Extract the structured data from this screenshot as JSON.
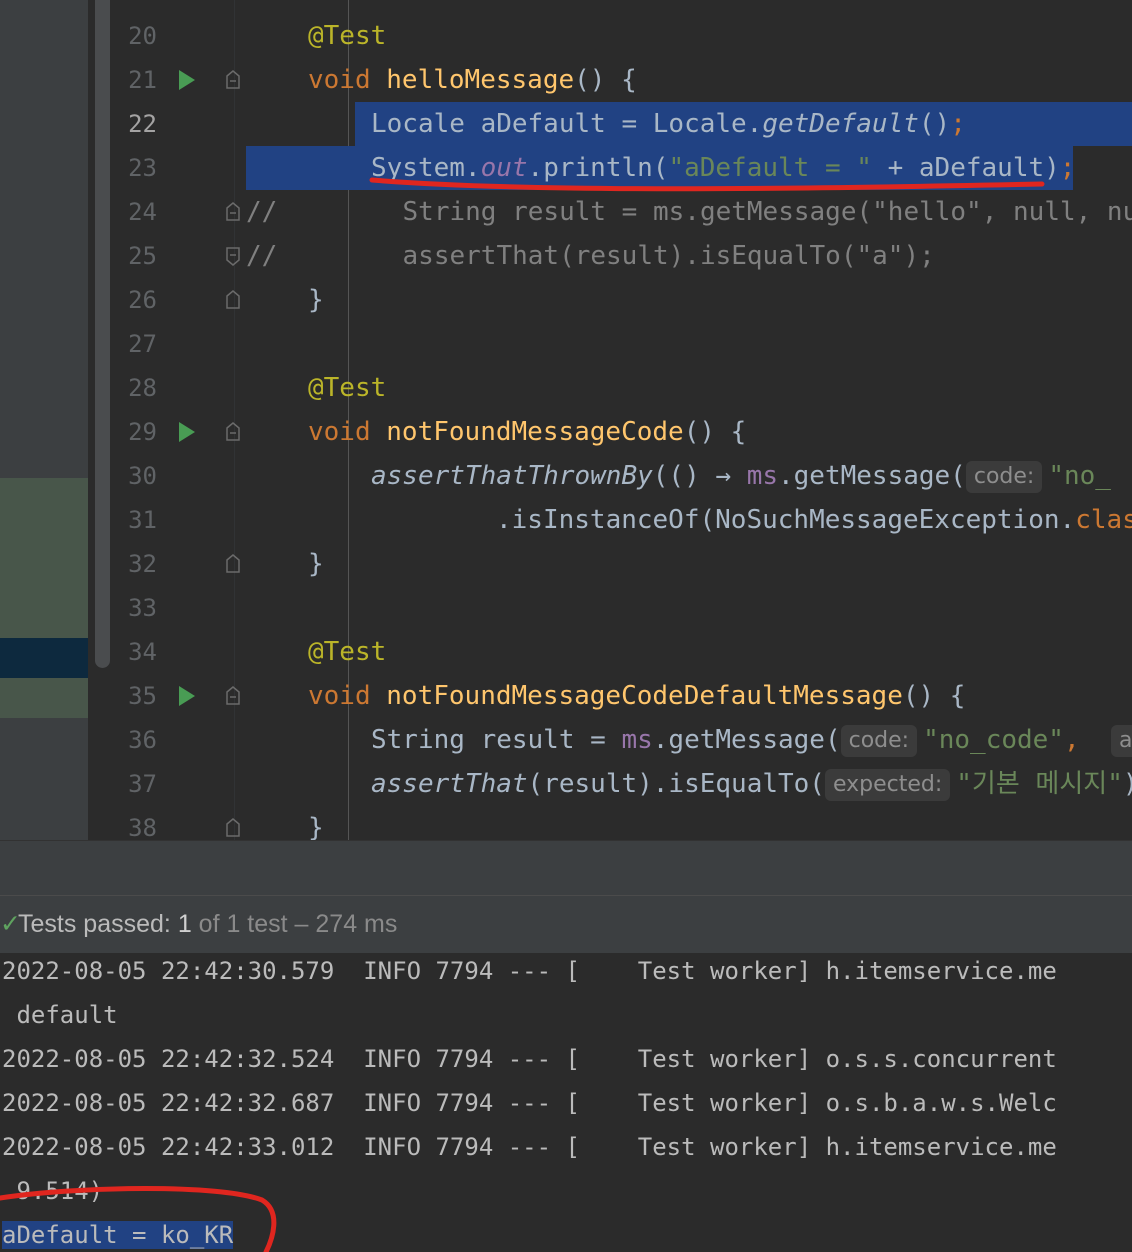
{
  "editor": {
    "lines": [
      {
        "num": "20",
        "run": false,
        "fold": false
      },
      {
        "num": "21",
        "run": true,
        "fold": true
      },
      {
        "num": "22",
        "run": false,
        "fold": false,
        "current": true
      },
      {
        "num": "23",
        "run": false,
        "fold": false
      },
      {
        "num": "24",
        "run": false,
        "fold": true
      },
      {
        "num": "25",
        "run": false,
        "fold": true
      },
      {
        "num": "26",
        "run": false,
        "fold": true
      },
      {
        "num": "27",
        "run": false,
        "fold": false
      },
      {
        "num": "28",
        "run": false,
        "fold": false
      },
      {
        "num": "29",
        "run": true,
        "fold": true
      },
      {
        "num": "30",
        "run": false,
        "fold": false
      },
      {
        "num": "31",
        "run": false,
        "fold": false
      },
      {
        "num": "32",
        "run": false,
        "fold": true
      },
      {
        "num": "33",
        "run": false,
        "fold": false
      },
      {
        "num": "34",
        "run": false,
        "fold": false
      },
      {
        "num": "35",
        "run": true,
        "fold": true
      },
      {
        "num": "36",
        "run": false,
        "fold": false
      },
      {
        "num": "37",
        "run": false,
        "fold": false
      },
      {
        "num": "38",
        "run": false,
        "fold": true
      }
    ],
    "code": {
      "l20_ann": "@Test",
      "l21_void": "void ",
      "l21_name": "helloMessage",
      "l21_rest": "() {",
      "l22_a": "Locale aDefault = Locale.",
      "l22_b": "getDefault",
      "l22_c": "()",
      "l22_d": ";",
      "l23_a": "System.",
      "l23_b": "out",
      "l23_c": ".println(",
      "l23_d": "\"aDefault = \"",
      "l23_e": " + aDefault)",
      "l23_f": ";",
      "l24": "//        String result = ms.getMessage(\"hello\", null, nu",
      "l25": "//        assertThat(result).isEqualTo(\"a\");",
      "l26": "}",
      "l28_ann": "@Test",
      "l29_void": "void ",
      "l29_name": "notFoundMessageCode",
      "l29_rest": "() {",
      "l30_a": "assertThatThrownBy",
      "l30_b": "(() → ",
      "l30_c": "ms",
      "l30_d": ".getMessage(",
      "l30_hint": "code:",
      "l30_e": "\"no_",
      "l31_a": ".isInstanceOf(NoSuchMessageException.",
      "l31_b": "clas",
      "l32": "}",
      "l34_ann": "@Test",
      "l35_void": "void ",
      "l35_name": "notFoundMessageCodeDefaultMessage",
      "l35_rest": "() {",
      "l36_a": "String result = ",
      "l36_b": "ms",
      "l36_c": ".getMessage(",
      "l36_hint": "code:",
      "l36_d": "\"no_code\"",
      "l36_e": ",  ",
      "l36_hint2": "ar",
      "l37_a": "assertThat",
      "l37_b": "(result).isEqualTo(",
      "l37_hint": "expected:",
      "l37_c": "\"기본 메시지\"",
      "l37_d": ")",
      "l38": "}"
    }
  },
  "status": {
    "check": "✓",
    "label": "Tests passed: ",
    "passed": "1",
    "of": " of 1 test – 274 ms"
  },
  "console": {
    "lines": [
      "2022-08-05 22:42:30.579  INFO 7794 --- [    Test worker] h.itemservice.me",
      " default",
      "2022-08-05 22:42:32.524  INFO 7794 --- [    Test worker] o.s.s.concurrent",
      "2022-08-05 22:42:32.687  INFO 7794 --- [    Test worker] o.s.b.a.w.s.Welc",
      "2022-08-05 22:42:33.012  INFO 7794 --- [    Test worker] h.itemservice.me",
      " 9.514)",
      "aDefault = ko_KR"
    ]
  },
  "colors": {
    "selection": "#214283",
    "annotation": "#bbb529",
    "keyword": "#cc7832",
    "method": "#ffc66d",
    "string": "#6a8759",
    "redMark": "#e0261f"
  }
}
